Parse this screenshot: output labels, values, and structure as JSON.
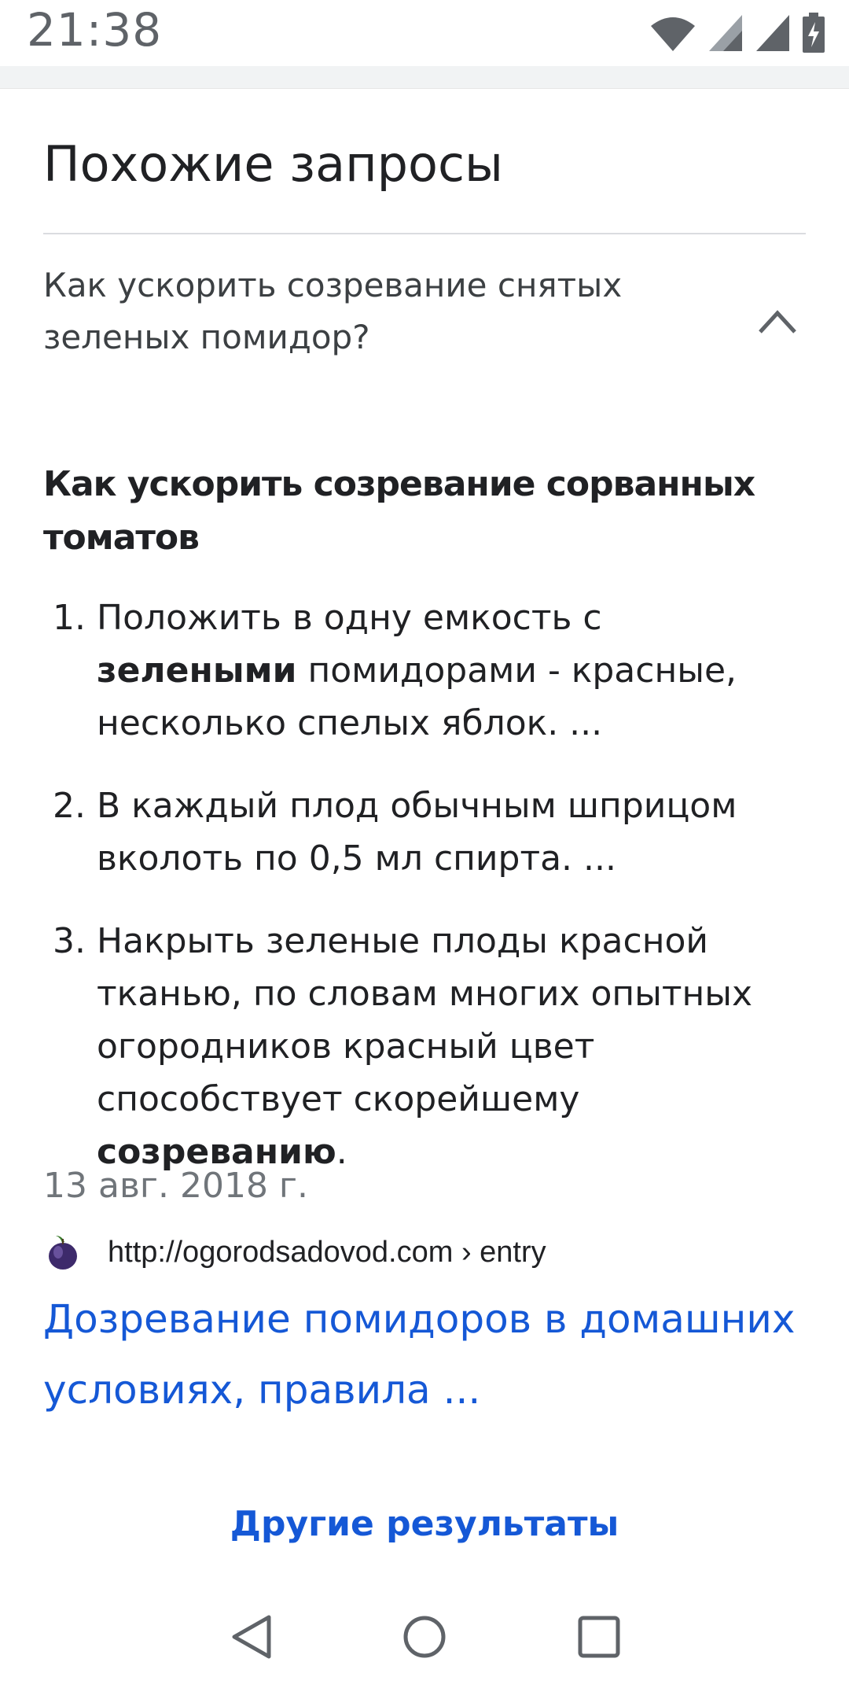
{
  "status_bar": {
    "time": "21:38",
    "icons": [
      "wifi-icon",
      "signal-icon",
      "signal-icon",
      "battery-charging-icon"
    ]
  },
  "related": {
    "title": "Похожие запросы",
    "question": "Как ускорить созревание снятых зеленых помидор?",
    "expanded": true
  },
  "answer": {
    "heading": "Как ускорить созревание сорванных томатов",
    "steps": [
      {
        "number": "1.",
        "before": "Положить в одну емкость с ",
        "bold": "зелеными",
        "after": " помидорами - красные, несколько спелых яблок. ..."
      },
      {
        "number": "2.",
        "before": "В каждый плод обычным шприцом вколоть по 0,5 мл спирта. ...",
        "bold": "",
        "after": ""
      },
      {
        "number": "3.",
        "before": "Накрыть зеленые плоды красной тканью, по словам многих опытных огородников красный цвет способствует скорейшему ",
        "bold": "созреванию",
        "after": "."
      }
    ],
    "date": "13 авг. 2018 г.",
    "source_url": "http://ogorodsadovod.com › entry",
    "link_text": "Дозревание помидоров в домашних условиях, правила ..."
  },
  "more_results": "Другие результаты",
  "nav_bar": {
    "icons": [
      "back-icon",
      "home-icon",
      "recents-icon"
    ]
  },
  "colors": {
    "link": "#1558d6",
    "text": "#202124",
    "muted": "#70757a"
  }
}
